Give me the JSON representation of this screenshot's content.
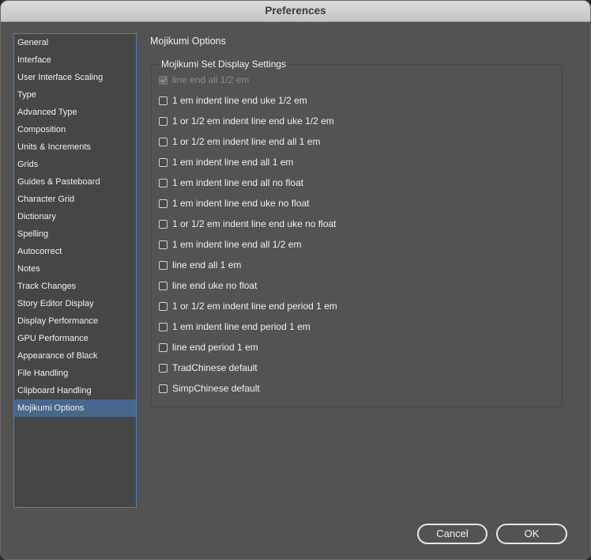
{
  "window": {
    "title": "Preferences"
  },
  "sidebar": {
    "items": [
      {
        "label": "General"
      },
      {
        "label": "Interface"
      },
      {
        "label": "User Interface Scaling"
      },
      {
        "label": "Type"
      },
      {
        "label": "Advanced Type"
      },
      {
        "label": "Composition"
      },
      {
        "label": "Units & Increments"
      },
      {
        "label": "Grids"
      },
      {
        "label": "Guides & Pasteboard"
      },
      {
        "label": "Character Grid"
      },
      {
        "label": "Dictionary"
      },
      {
        "label": "Spelling"
      },
      {
        "label": "Autocorrect"
      },
      {
        "label": "Notes"
      },
      {
        "label": "Track Changes"
      },
      {
        "label": "Story Editor Display"
      },
      {
        "label": "Display Performance"
      },
      {
        "label": "GPU Performance"
      },
      {
        "label": "Appearance of Black"
      },
      {
        "label": "File Handling"
      },
      {
        "label": "Clipboard Handling"
      },
      {
        "label": "Mojikumi Options"
      }
    ],
    "selected": "Mojikumi Options"
  },
  "content": {
    "title": "Mojikumi Options",
    "group_label": "Mojikumi Set Display Settings",
    "options": [
      {
        "label": "line end all 1/2 em",
        "checked": true,
        "disabled": true
      },
      {
        "label": "1 em indent line end uke 1/2 em",
        "checked": false,
        "disabled": false
      },
      {
        "label": "1 or 1/2 em indent line end uke 1/2 em",
        "checked": false,
        "disabled": false
      },
      {
        "label": "1 or 1/2 em indent line end all 1 em",
        "checked": false,
        "disabled": false
      },
      {
        "label": "1 em indent line end all 1 em",
        "checked": false,
        "disabled": false
      },
      {
        "label": "1 em indent line end all no float",
        "checked": false,
        "disabled": false
      },
      {
        "label": "1 em indent line end uke no float",
        "checked": false,
        "disabled": false
      },
      {
        "label": "1 or 1/2 em indent line end uke no float",
        "checked": false,
        "disabled": false
      },
      {
        "label": "1 em indent line end all 1/2 em",
        "checked": false,
        "disabled": false
      },
      {
        "label": "line end all 1 em",
        "checked": false,
        "disabled": false
      },
      {
        "label": "line end uke no float",
        "checked": false,
        "disabled": false
      },
      {
        "label": "1 or 1/2 em indent line end period 1 em",
        "checked": false,
        "disabled": false
      },
      {
        "label": "1 em indent line end period 1 em",
        "checked": false,
        "disabled": false
      },
      {
        "label": "line end period 1 em",
        "checked": false,
        "disabled": false
      },
      {
        "label": "TradChinese default",
        "checked": false,
        "disabled": false
      },
      {
        "label": "SimpChinese default",
        "checked": false,
        "disabled": false
      }
    ]
  },
  "footer": {
    "cancel_label": "Cancel",
    "ok_label": "OK"
  }
}
